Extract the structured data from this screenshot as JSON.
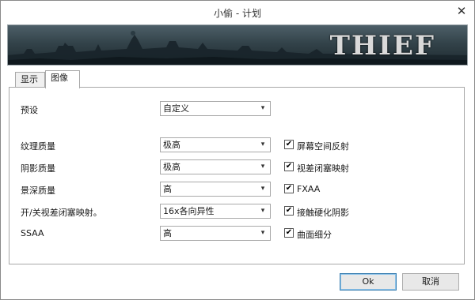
{
  "window": {
    "title": "小偷 - 计划",
    "close_glyph": "✕"
  },
  "banner": {
    "logo_text": "THIEF"
  },
  "tabs": [
    {
      "label": "显示"
    },
    {
      "label": "图像"
    }
  ],
  "preset": {
    "label": "预设",
    "value": "自定义"
  },
  "settings": [
    {
      "label": "纹理质量",
      "value": "极高"
    },
    {
      "label": "阴影质量",
      "value": "极高"
    },
    {
      "label": "景深质量",
      "value": "高"
    },
    {
      "label": "开/关视差闭塞映射。",
      "value": "16x各向异性"
    },
    {
      "label": "SSAA",
      "value": "高"
    }
  ],
  "checkboxes": [
    {
      "label": "屏幕空间反射",
      "checked": "✔"
    },
    {
      "label": "视差闭塞映射",
      "checked": "✔"
    },
    {
      "label": "FXAA",
      "checked": "✔"
    },
    {
      "label": "接触硬化阴影",
      "checked": "✔"
    },
    {
      "label": "曲面细分",
      "checked": "✔"
    }
  ],
  "icons": {
    "dropdown": "▾"
  },
  "buttons": {
    "ok": "Ok",
    "cancel": "取消"
  }
}
